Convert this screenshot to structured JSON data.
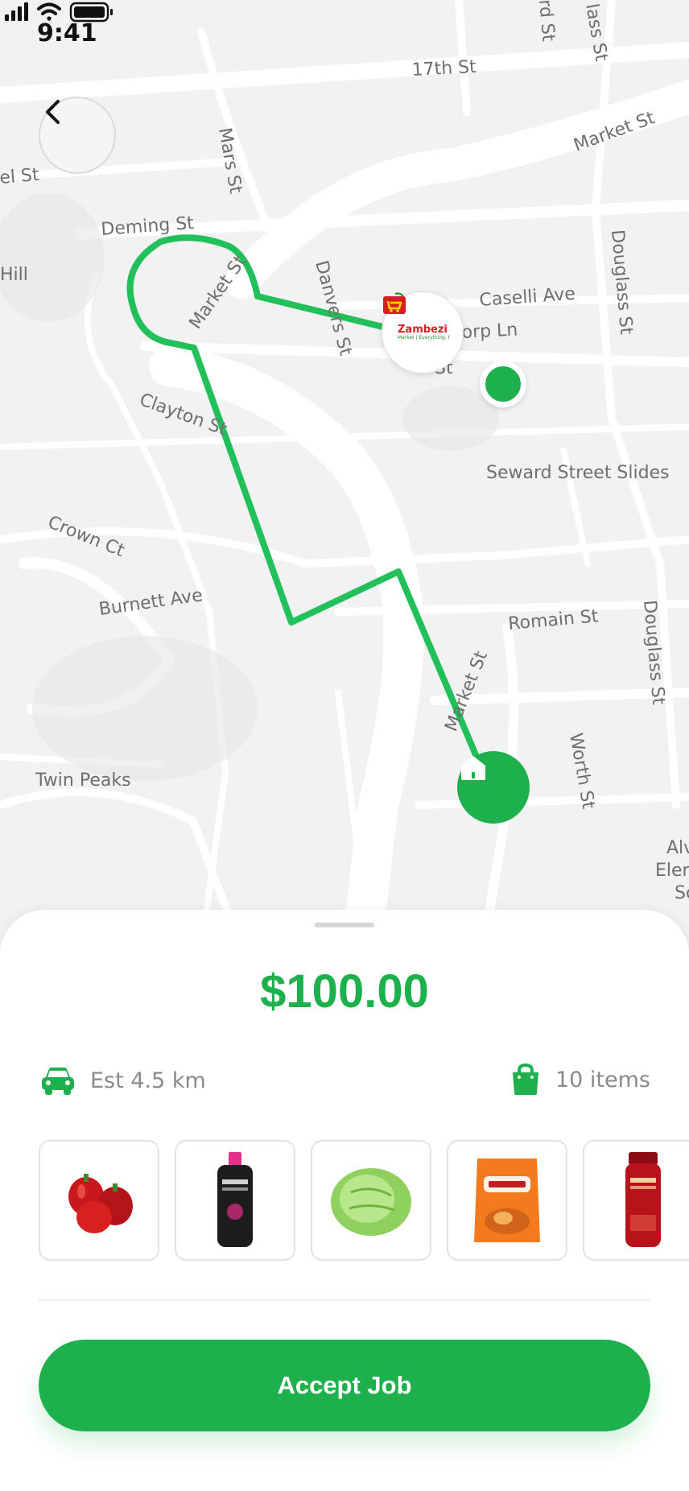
{
  "status_bar": {
    "time": "9:41"
  },
  "map": {
    "streets": {
      "s17th": "17th St",
      "market_top": "Market St",
      "lass": "lass St",
      "rd_st": "rd St",
      "el_st": "el St",
      "mars": "Mars St",
      "deming": "Deming St",
      "hill": "Hill",
      "market_loop": "Market St",
      "danvers": "Danvers St",
      "caselli": "Caselli Ave",
      "douglass_upper": "Douglass St",
      "corp_ln": "orp Ln",
      "st_fragment": "St",
      "clayton": "Clayton St",
      "seward": "Seward Street Slides",
      "crown": "Crown Ct",
      "burnett": "Burnett Ave",
      "romain": "Romain St",
      "douglass_lower": "Douglass St",
      "market_lower": "Market St",
      "worth": "Worth St",
      "twin_peaks": "Twin Peaks",
      "alv": "Alv",
      "elen": "Elen",
      "sc": "Sc"
    },
    "store": {
      "name": "Zambezi",
      "tagline": "Market | Everything, Every time"
    }
  },
  "sheet": {
    "price": "$100.00",
    "distance": "Est 4.5 km",
    "items_count": "10 items",
    "products": [
      {
        "name": "red-bell-peppers",
        "color": "#c8171d"
      },
      {
        "name": "elseve-shampoo-black",
        "color": "#1c1c1c"
      },
      {
        "name": "iceberg-lettuce",
        "color": "#8fd05e"
      },
      {
        "name": "kurleez-chips",
        "color": "#f47a1f"
      },
      {
        "name": "elvive-shampoo-red",
        "color": "#b8121b"
      }
    ],
    "accept_label": "Accept Job"
  },
  "colors": {
    "accent": "#1db04c",
    "route": "#22c05a"
  }
}
